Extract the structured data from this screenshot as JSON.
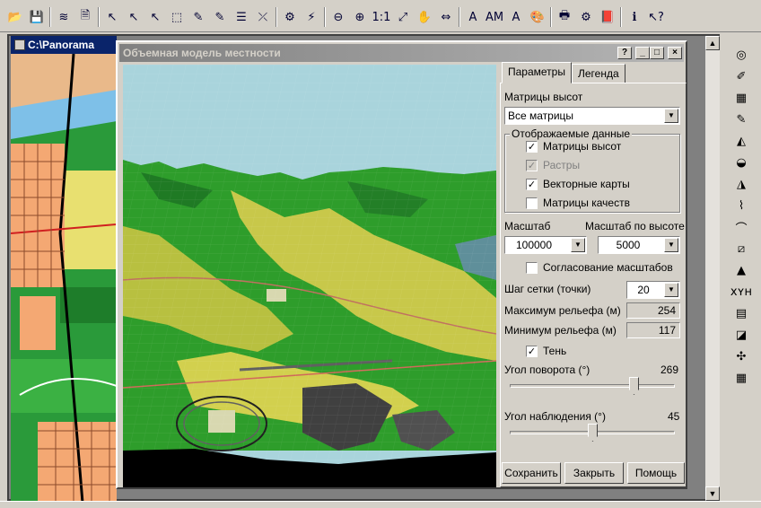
{
  "toolbar": {
    "icons": [
      "open-icon",
      "save-icon",
      "layers-icon",
      "document-icon",
      "select-icon",
      "select-add-icon",
      "select-remove-icon",
      "select-box-icon",
      "select-rect-icon",
      "select-point-icon",
      "list-icon",
      "select-clear-icon",
      "navigator-icon",
      "lightning-icon",
      "zoom-out-icon",
      "zoom-in-icon",
      "zoom-1to1-icon",
      "fit-icon",
      "hand-icon",
      "pan-icon",
      "text-a-icon",
      "text-am-icon",
      "text-box-icon",
      "palette-icon",
      "print-icon",
      "settings-icon",
      "book-icon",
      "info-icon",
      "help-pointer-icon"
    ]
  },
  "map_window": {
    "title": "C:\\Panorama"
  },
  "dialog": {
    "title": "Объемная модель местности",
    "title_buttons": [
      "?",
      "_",
      "□",
      "×"
    ]
  },
  "tabs": {
    "params": "Параметры",
    "legend": "Легенда"
  },
  "params": {
    "matrices_label": "Матрицы высот",
    "matrices_value": "Все матрицы",
    "display_group": "Отображаемые данные",
    "checkboxes": [
      {
        "label": "Матрицы высот",
        "checked": true,
        "enabled": true
      },
      {
        "label": "Растры",
        "checked": true,
        "enabled": false
      },
      {
        "label": "Векторные карты",
        "checked": true,
        "enabled": true
      },
      {
        "label": "Матрицы качеств",
        "checked": false,
        "enabled": true
      }
    ],
    "scale_label": "Масштаб",
    "height_scale_label": "Масштаб по высоте",
    "scale_value": "100000",
    "height_scale_value": "5000",
    "match_scales_label": "Согласование масштабов",
    "match_scales_checked": false,
    "grid_step_label": "Шаг сетки (точки)",
    "grid_step_value": "20",
    "max_relief_label": "Максимум рельефа (м)",
    "max_relief_value": "254",
    "min_relief_label": "Минимум рельефа (м)",
    "min_relief_value": "117",
    "shadow_label": "Тень",
    "shadow_checked": true,
    "rotation_label": "Угол поворота (°)",
    "rotation_value": "269",
    "rotation_fraction": 0.75,
    "view_angle_label": "Угол наблюдения (°)",
    "view_angle_value": "45",
    "view_angle_fraction": 0.5
  },
  "buttons": {
    "save": "Сохранить",
    "close": "Закрыть",
    "help": "Помощь"
  },
  "vtoolbar": {
    "icons": [
      "globe-icon",
      "brush-icon",
      "grid-icon",
      "pen-icon",
      "surface-icon",
      "section-icon",
      "relief-icon",
      "profile-icon",
      "arc-icon",
      "diagonal-icon",
      "terrain-icon",
      "xyh-icon",
      "xy-table-icon",
      "layers-view-icon",
      "network-icon",
      "table-icon"
    ]
  },
  "colors": {
    "sky": "#a9d4dc",
    "terrain_green": "#2e9d2b",
    "terrain_yellow": "#c8c84a",
    "title_active": "#0a246a",
    "title_inactive": "#808080"
  }
}
